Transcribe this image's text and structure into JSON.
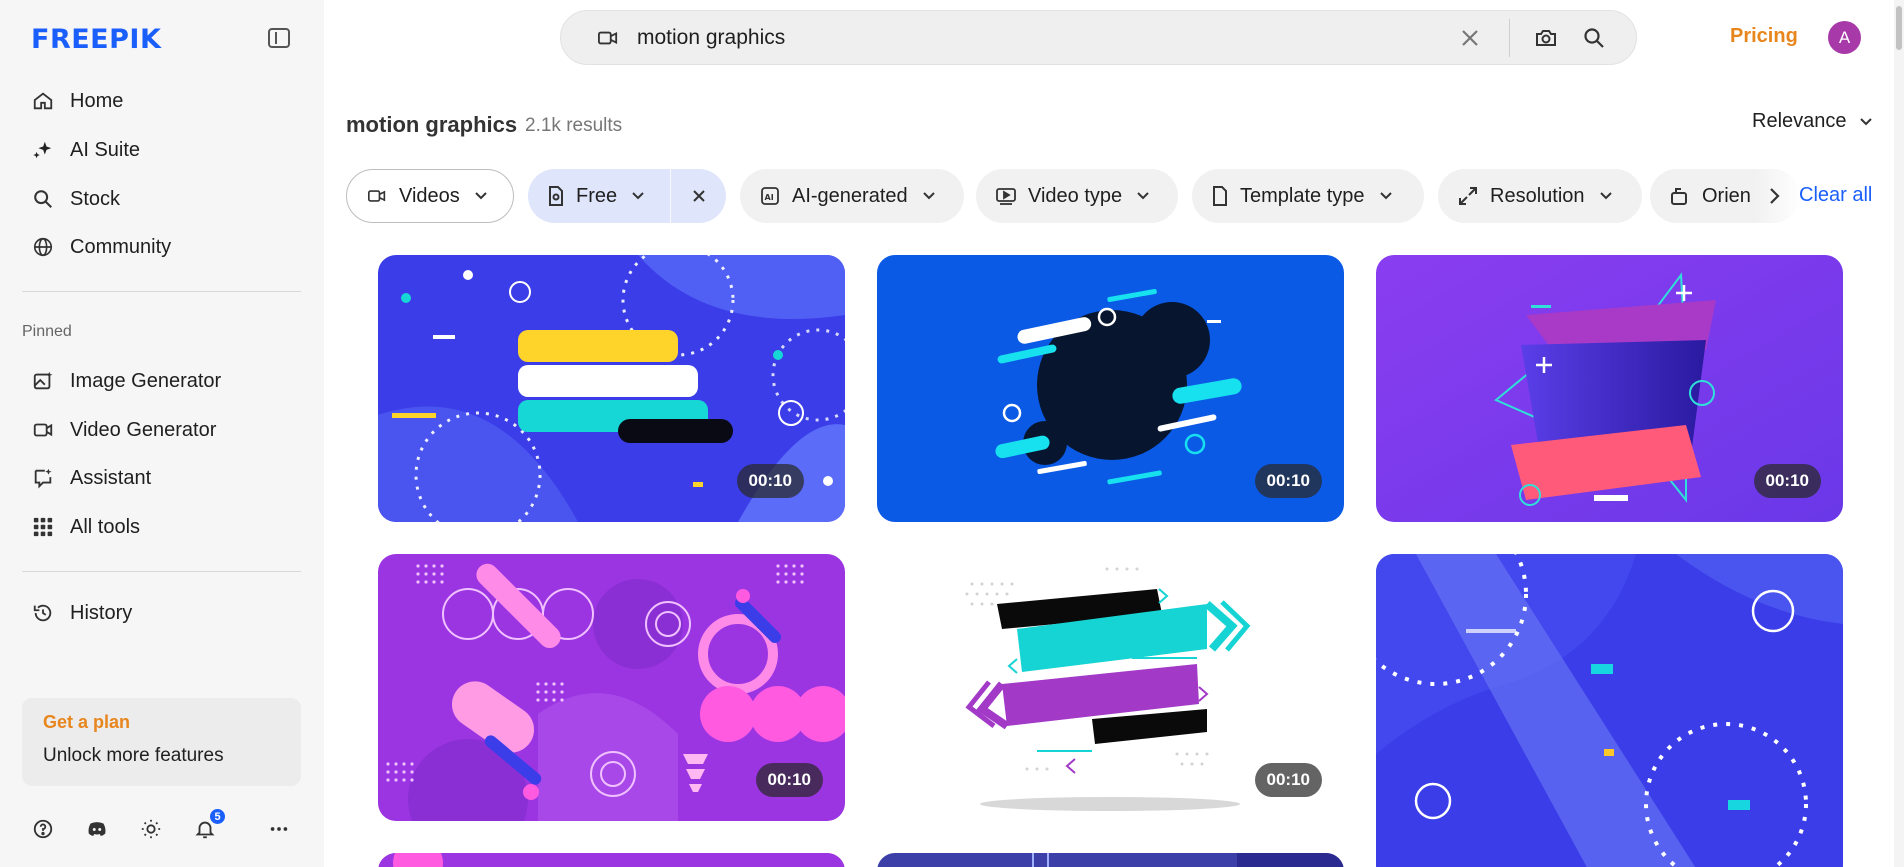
{
  "brand": {
    "logo": "FREEPIK",
    "accent": "#1a5ffb",
    "orange": "#e8861e"
  },
  "sidebar": {
    "main_nav": [
      {
        "label": "Home",
        "icon": "home-icon"
      },
      {
        "label": "AI Suite",
        "icon": "sparkle-icon"
      },
      {
        "label": "Stock",
        "icon": "search-icon"
      },
      {
        "label": "Community",
        "icon": "globe-icon"
      }
    ],
    "pinned_label": "Pinned",
    "pinned_nav": [
      {
        "label": "Image Generator",
        "icon": "image-gen-icon"
      },
      {
        "label": "Video Generator",
        "icon": "video-camera-icon"
      },
      {
        "label": "Assistant",
        "icon": "chat-icon"
      },
      {
        "label": "All tools",
        "icon": "grid-icon"
      }
    ],
    "history_label": "History",
    "plan": {
      "title": "Get a plan",
      "subtitle": "Unlock more features"
    },
    "notifications_count": "5"
  },
  "header": {
    "search_value": "motion graphics",
    "pricing_label": "Pricing",
    "avatar_initial": "A"
  },
  "results": {
    "title": "motion graphics",
    "count": "2.1k results",
    "sort_label": "Relevance"
  },
  "filters": {
    "videos": "Videos",
    "free": "Free",
    "ai_generated": "AI-generated",
    "video_type": "Video type",
    "template_type": "Template type",
    "resolution": "Resolution",
    "orientation": "Orien",
    "clear_all": "Clear all"
  },
  "cards": [
    {
      "duration": "00:10"
    },
    {
      "duration": "00:10"
    },
    {
      "duration": "00:10"
    },
    {
      "duration": "00:10"
    },
    {
      "duration": "00:10"
    }
  ]
}
